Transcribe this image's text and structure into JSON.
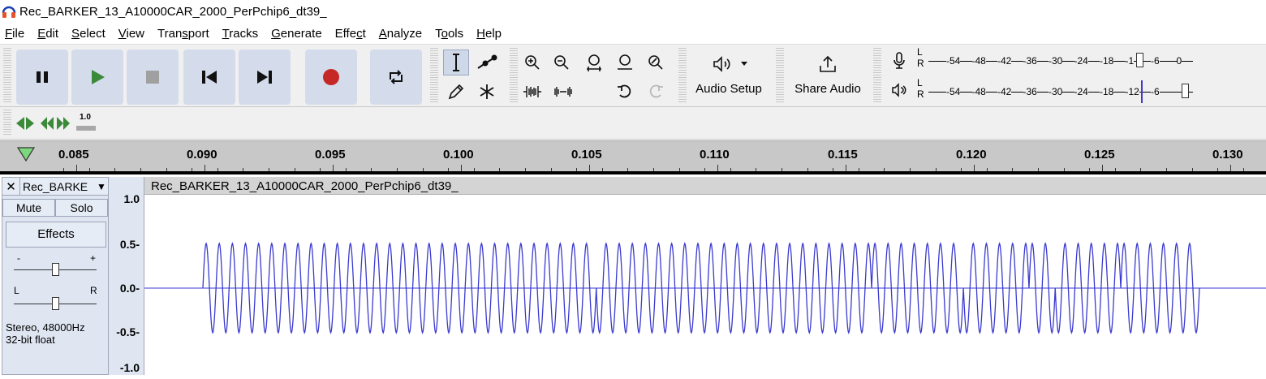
{
  "window": {
    "title": "Rec_BARKER_13_A10000CAR_2000_PerPchip6_dt39_",
    "icon": "audacity-headphones-icon"
  },
  "menu": [
    {
      "mnemonic": "F",
      "rest": "ile"
    },
    {
      "mnemonic": "E",
      "rest": "dit"
    },
    {
      "mnemonic": "S",
      "rest": "elect"
    },
    {
      "mnemonic": "V",
      "rest": "iew"
    },
    {
      "pre": "Tran",
      "mnemonic": "s",
      "rest": "port"
    },
    {
      "mnemonic": "T",
      "rest": "racks"
    },
    {
      "mnemonic": "G",
      "rest": "enerate"
    },
    {
      "pre": "Effe",
      "mnemonic": "c",
      "rest": "t"
    },
    {
      "mnemonic": "A",
      "rest": "nalyze"
    },
    {
      "pre": "T",
      "mnemonic": "o",
      "rest": "ols"
    },
    {
      "mnemonic": "H",
      "rest": "elp"
    }
  ],
  "transport": {
    "buttons": [
      "pause",
      "play",
      "stop",
      "skip-to-start",
      "skip-to-end",
      "record",
      "loop"
    ],
    "colors": {
      "play": "#3a8a3a",
      "record": "#c62828",
      "stop": "#a0a0a0",
      "button_bg": "#d4dcec"
    }
  },
  "audio_setup": {
    "label": "Audio Setup"
  },
  "share_audio": {
    "label": "Share Audio"
  },
  "meters": {
    "record_ticks": [
      "-54",
      "-48",
      "-42",
      "-36",
      "-30",
      "-24",
      "-18",
      "-1",
      "-6",
      "0"
    ],
    "playback_ticks": [
      "-54",
      "-48",
      "-42",
      "-36",
      "-30",
      "-24",
      "-18",
      "-12",
      "-6"
    ],
    "channel_l": "L",
    "channel_r": "R"
  },
  "play_at_speed": {
    "speed_label": "1.0"
  },
  "timeline": {
    "ticks": [
      "0.085",
      "0.090",
      "0.095",
      "0.100",
      "0.105",
      "0.110",
      "0.115",
      "0.120",
      "0.125",
      "0.130"
    ]
  },
  "track": {
    "short_name": "Rec_BARKE",
    "clip_name": "Rec_BARKER_13_A10000CAR_2000_PerPchip6_dt39_",
    "mute_label": "Mute",
    "solo_label": "Solo",
    "effects_label": "Effects",
    "gain_minus": "-",
    "gain_plus": "+",
    "pan_left": "L",
    "pan_right": "R",
    "format_line1": "Stereo, 48000Hz",
    "format_line2": "32-bit float",
    "amplitude_labels": [
      "1.0",
      "0.5-",
      "0.0-",
      "-0.5-",
      "-1.0"
    ],
    "waveform_color": "#3a3ad0",
    "waveform_amplitude": 0.55,
    "cycles": 76,
    "phase_flip_cycle_indices": [
      30,
      51,
      58,
      63,
      65,
      70
    ]
  }
}
